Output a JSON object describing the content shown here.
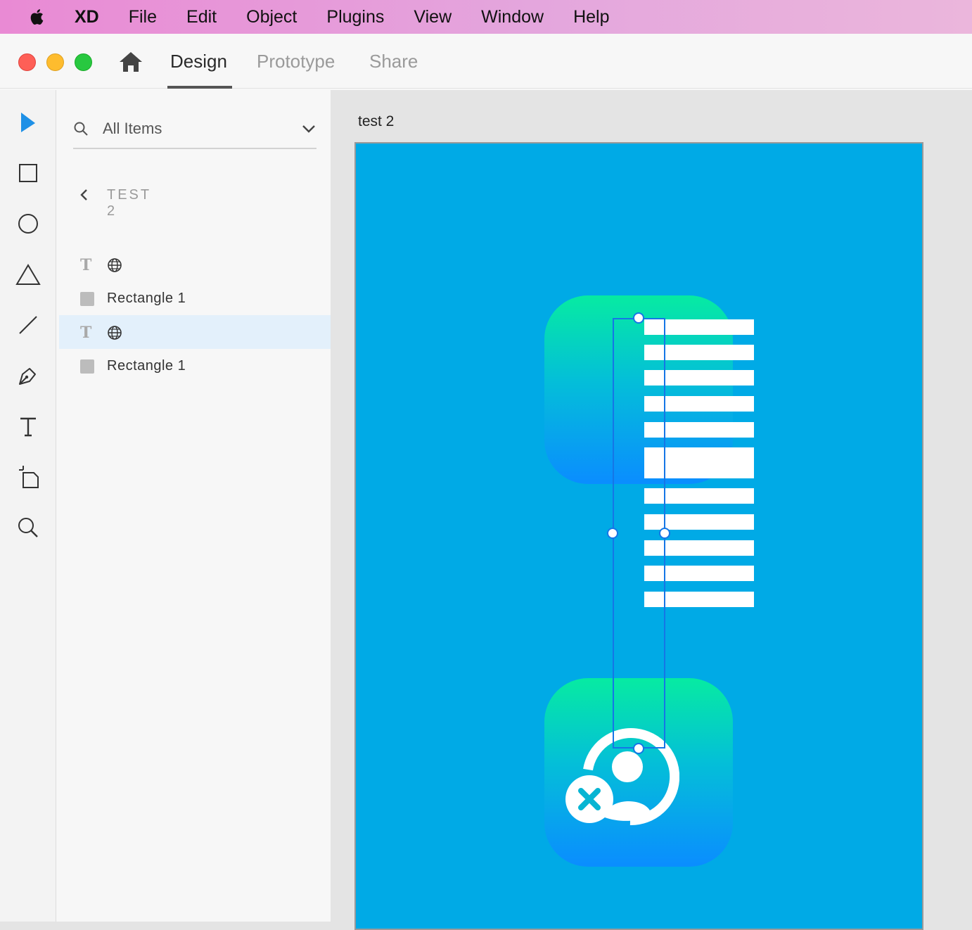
{
  "menubar": {
    "apple_icon": "apple-logo",
    "items": [
      "XD",
      "File",
      "Edit",
      "Object",
      "Plugins",
      "View",
      "Window",
      "Help"
    ]
  },
  "window": {
    "tabs": [
      {
        "label": "Design",
        "active": true
      },
      {
        "label": "Prototype",
        "active": false
      },
      {
        "label": "Share",
        "active": false
      }
    ],
    "traffic_colors": {
      "close": "#fe5f57",
      "minimize": "#febc2e",
      "zoom": "#28c840"
    }
  },
  "toolbar": {
    "tools": [
      "select-tool",
      "rectangle-tool",
      "ellipse-tool",
      "polygon-tool",
      "line-tool",
      "pen-tool",
      "text-tool",
      "artboard-tool",
      "zoom-tool"
    ],
    "accent": "#1e90e6"
  },
  "layers": {
    "filter_label": "All Items",
    "breadcrumb": "TEST 2",
    "rows": [
      {
        "type": "text",
        "name": "",
        "selected": false
      },
      {
        "type": "rectangle",
        "name": "Rectangle 1",
        "selected": false
      },
      {
        "type": "text",
        "name": "",
        "selected": true
      },
      {
        "type": "rectangle",
        "name": "Rectangle 1",
        "selected": false
      }
    ]
  },
  "canvas": {
    "artboard_label": "test 2",
    "artboard_color": "#00aae6",
    "icon_gradient": [
      "#06eba2",
      "#0a8dff"
    ],
    "selection_color": "#1576e6"
  }
}
